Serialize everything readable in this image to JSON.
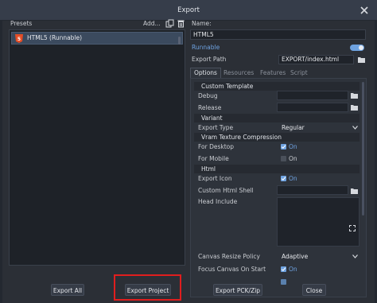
{
  "window": {
    "title": "Export"
  },
  "presets": {
    "header": "Presets",
    "add_label": "Add...",
    "items": [
      {
        "label": "HTML5 (Runnable)",
        "icon": "html5-icon"
      }
    ]
  },
  "preset_detail": {
    "name_label": "Name:",
    "name_value": "HTML5",
    "runnable_label": "Runnable",
    "runnable_on": true,
    "export_path_label": "Export Path",
    "export_path_value": "EXPORT/index.html"
  },
  "tabs": [
    "Options",
    "Resources",
    "Features",
    "Script"
  ],
  "options": {
    "custom_template_header": "Custom Template",
    "debug_label": "Debug",
    "release_label": "Release",
    "variant_header": "Variant",
    "export_type_label": "Export Type",
    "export_type_value": "Regular",
    "vram_header": "Vram Texture Compression",
    "for_desktop_label": "For Desktop",
    "for_desktop_value": "On",
    "for_mobile_label": "For Mobile",
    "for_mobile_value": "On",
    "html_header": "Html",
    "export_icon_label": "Export Icon",
    "export_icon_value": "On",
    "custom_shell_label": "Custom Html Shell",
    "head_include_label": "Head Include",
    "canvas_policy_label": "Canvas Resize Policy",
    "canvas_policy_value": "Adaptive",
    "focus_canvas_label": "Focus Canvas On Start",
    "focus_canvas_value": "On"
  },
  "buttons": {
    "export_all": "Export All",
    "export_project": "Export Project",
    "export_pck": "Export PCK/Zip",
    "close": "Close"
  },
  "colors": {
    "accent": "#6ea2e0",
    "highlight": "#e01e1e"
  }
}
